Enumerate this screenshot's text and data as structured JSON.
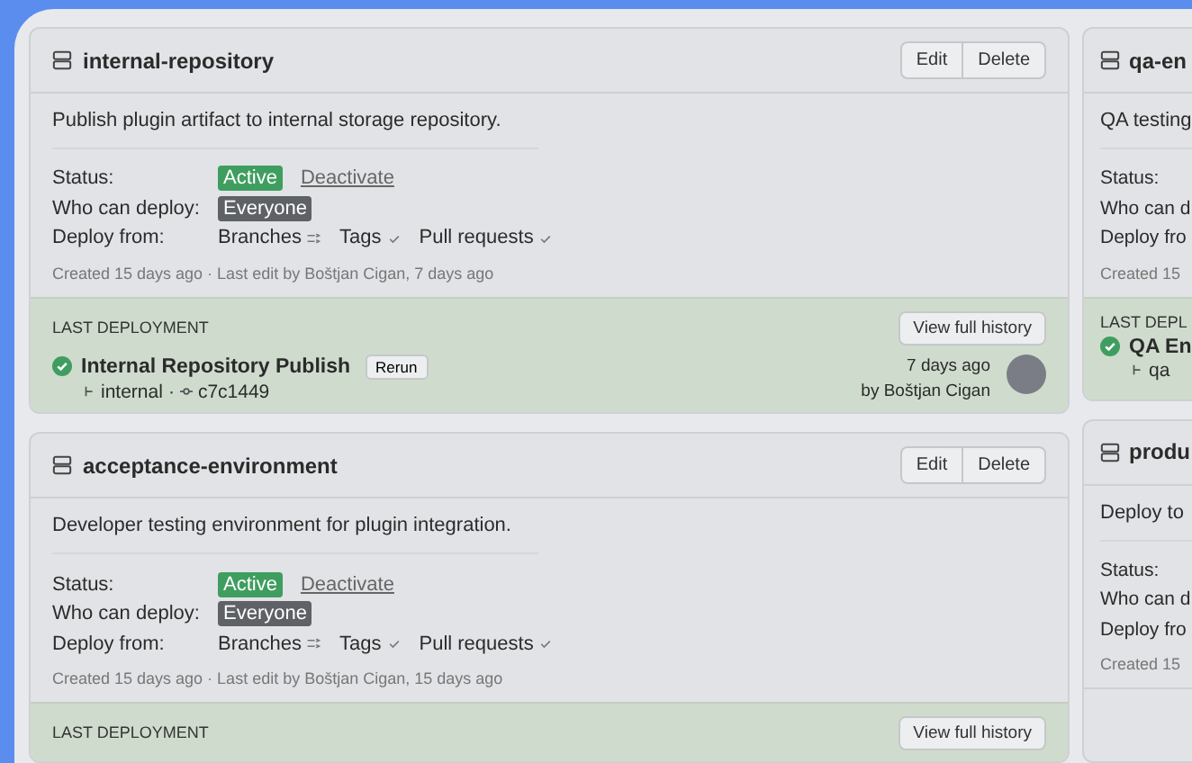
{
  "cards": [
    {
      "name": "internal-repository",
      "actions": [
        "Edit",
        "Delete"
      ],
      "description": "Publish plugin artifact to internal storage repository.",
      "status_label": "Status:",
      "status": "Active",
      "status_action": "Deactivate",
      "who_label": "Who can deploy:",
      "who": "Everyone",
      "from_label": "Deploy from:",
      "sources": [
        {
          "label": "Branches",
          "kind": "filter"
        },
        {
          "label": "Tags",
          "kind": "check"
        },
        {
          "label": "Pull requests",
          "kind": "check"
        }
      ],
      "meta": "Created 15 days ago · Last edit by Boštjan Cigan, 7 days ago",
      "last_deployment": {
        "heading": "LAST DEPLOYMENT",
        "history_button": "View full history",
        "title": "Internal Repository Publish",
        "rerun": "Rerun",
        "branch": "internal",
        "separator": "·",
        "commit": "c7c1449",
        "time": "7 days ago",
        "by": "by Boštjan Cigan"
      }
    },
    {
      "name": "acceptance-environment",
      "actions": [
        "Edit",
        "Delete"
      ],
      "description": "Developer testing environment for plugin integration.",
      "status_label": "Status:",
      "status": "Active",
      "status_action": "Deactivate",
      "who_label": "Who can deploy:",
      "who": "Everyone",
      "from_label": "Deploy from:",
      "sources": [
        {
          "label": "Branches",
          "kind": "filter"
        },
        {
          "label": "Tags",
          "kind": "check"
        },
        {
          "label": "Pull requests",
          "kind": "check"
        }
      ],
      "meta": "Created 15 days ago · Last edit by Boštjan Cigan, 15 days ago",
      "last_deployment": {
        "heading": "LAST DEPLOYMENT",
        "history_button": "View full history"
      }
    }
  ],
  "side_cards": [
    {
      "name": "qa-en",
      "description": "QA testing",
      "status_label": "Status:",
      "who_label": "Who can d",
      "from_label": "Deploy fro",
      "meta": "Created 15",
      "last_deployment": {
        "heading": "LAST DEPL",
        "title": "QA En",
        "branch": "qa"
      }
    },
    {
      "name": "produ",
      "description": "Deploy to",
      "status_label": "Status:",
      "who_label": "Who can d",
      "from_label": "Deploy fro",
      "meta": "Created 15"
    }
  ]
}
